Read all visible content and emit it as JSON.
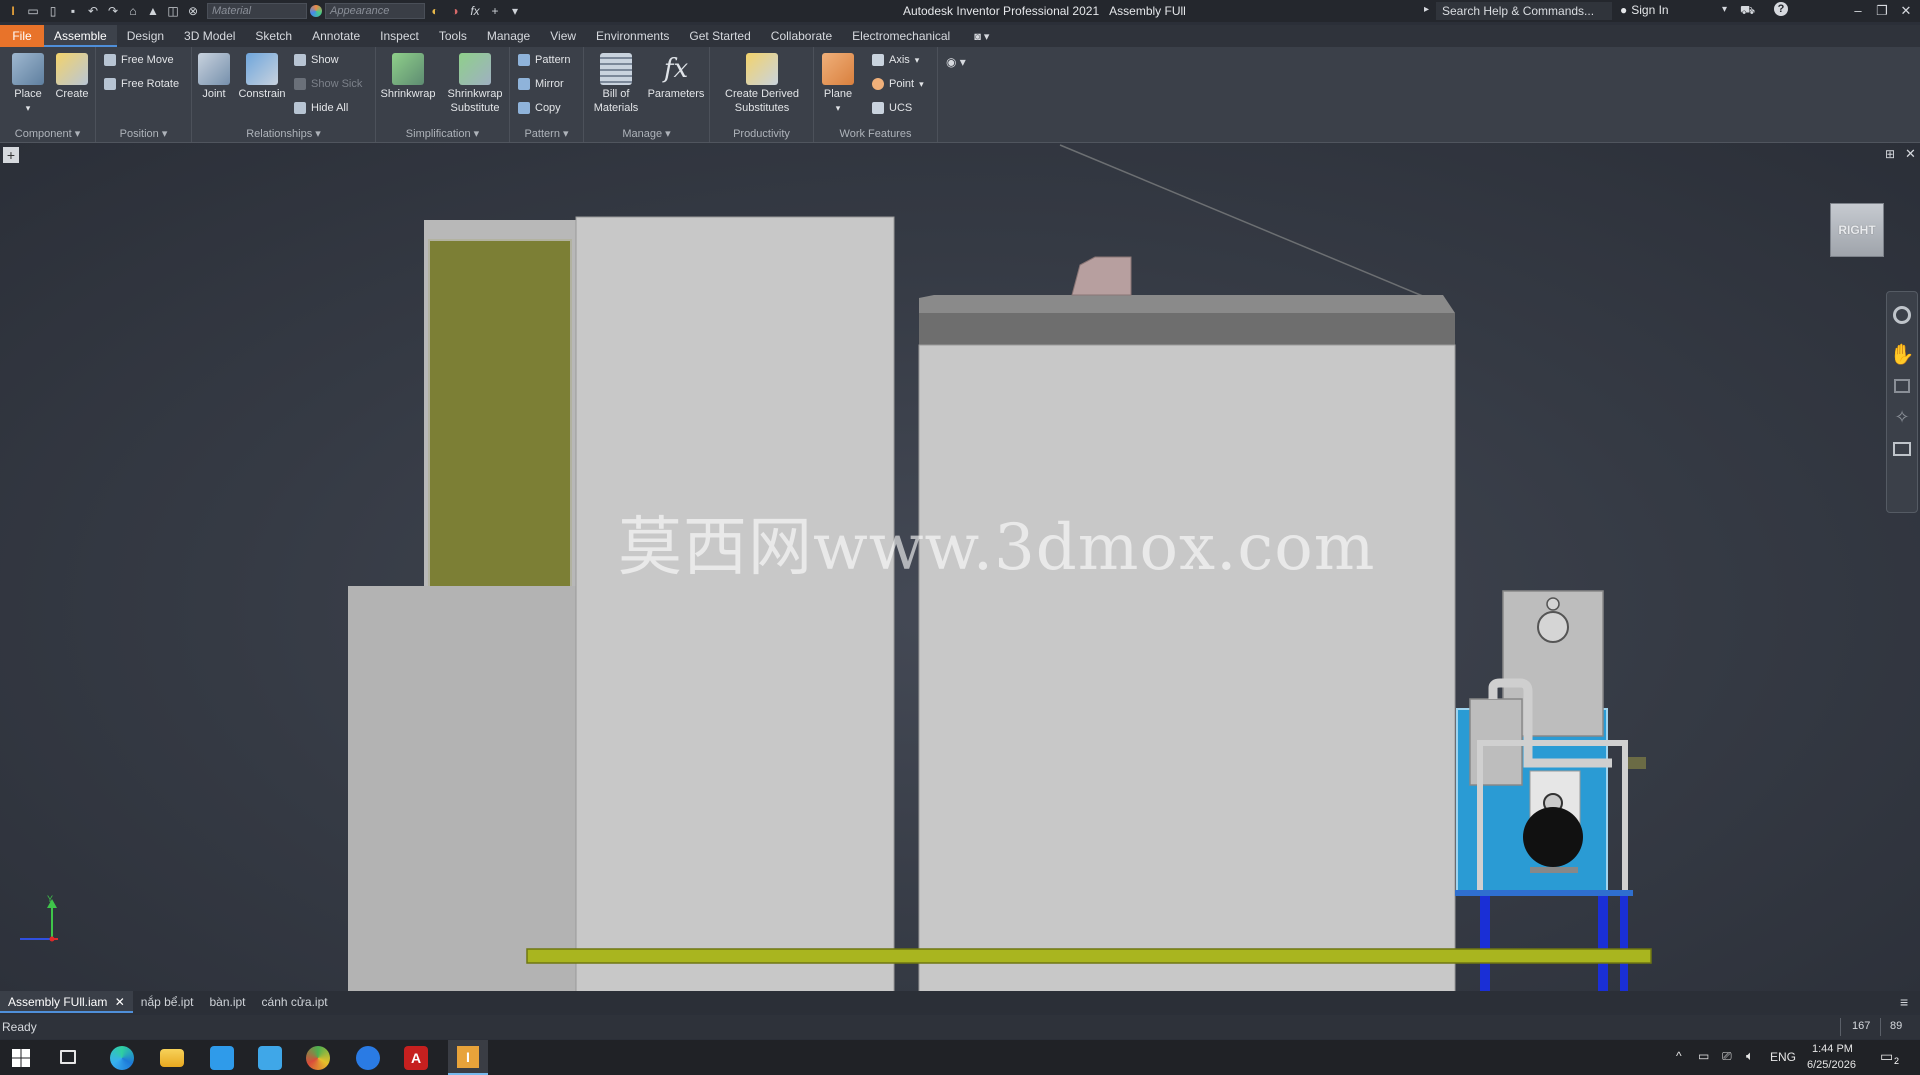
{
  "title_bar": {
    "app_title": "Autodesk Inventor Professional 2021",
    "document_title": "Assembly FUll",
    "material_placeholder": "Material",
    "appearance_placeholder": "Appearance",
    "search_placeholder": "Search Help & Commands...",
    "sign_in": "Sign In"
  },
  "tabs": [
    "File",
    "Assemble",
    "Design",
    "3D Model",
    "Sketch",
    "Annotate",
    "Inspect",
    "Tools",
    "Manage",
    "View",
    "Environments",
    "Get Started",
    "Collaborate",
    "Electromechanical"
  ],
  "active_tab": "Assemble",
  "ribbon": {
    "component": {
      "label": "Component",
      "place": "Place",
      "create": "Create"
    },
    "position": {
      "label": "Position",
      "free_move": "Free Move",
      "free_rotate": "Free Rotate"
    },
    "relationships": {
      "label": "Relationships",
      "joint": "Joint",
      "constrain": "Constrain",
      "show": "Show",
      "show_sick": "Show Sick",
      "hide_all": "Hide All"
    },
    "simplification": {
      "label": "Simplification",
      "shrinkwrap": "Shrinkwrap",
      "shrinkwrap_substitute_1": "Shrinkwrap",
      "shrinkwrap_substitute_2": "Substitute"
    },
    "pattern": {
      "label": "Pattern",
      "pattern": "Pattern",
      "mirror": "Mirror",
      "copy": "Copy"
    },
    "manage": {
      "label": "Manage",
      "bom_1": "Bill of",
      "bom_2": "Materials",
      "parameters": "Parameters"
    },
    "productivity": {
      "label": "Productivity",
      "derived_1": "Create Derived",
      "derived_2": "Substitutes"
    },
    "work_features": {
      "label": "Work Features",
      "plane": "Plane",
      "axis": "Axis",
      "point": "Point",
      "ucs": "UCS"
    }
  },
  "viewport": {
    "viewcube_label": "RIGHT",
    "watermark": "莫西网www.3dmox.com",
    "axis_y": "Y"
  },
  "document_tabs": [
    "Assembly FUll.iam",
    "nắp bể.ipt",
    "bàn.ipt",
    "cánh cửa.ipt"
  ],
  "active_document": "Assembly FUll.iam",
  "status": {
    "text": "Ready",
    "count_a": "167",
    "count_b": "89"
  },
  "taskbar": {
    "language": "ENG",
    "time": "1:44 PM",
    "date": "6/25/2026",
    "notifications": "2"
  },
  "colors": {
    "accent_orange": "#e8732a",
    "active_blue": "#4f8fd9",
    "model_grey": "#c9c9c9",
    "olive_panel": "#7c7f35",
    "base_yellow_green": "#a9b51f",
    "machine_blue": "#2a9bd4"
  }
}
